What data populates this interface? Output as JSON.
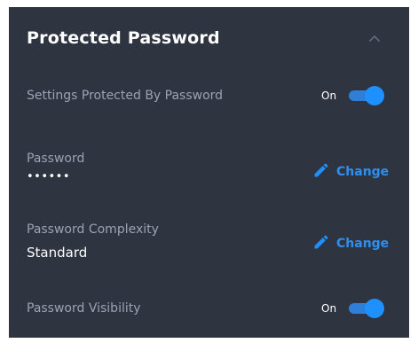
{
  "section": {
    "title": "Protected Password",
    "collapse_icon": "chevron-up-icon"
  },
  "settings": {
    "protected_by_password": {
      "label": "Settings Protected By Password",
      "state": "On"
    },
    "password": {
      "label": "Password",
      "value": "••••••",
      "action": "Change",
      "action_icon": "pencil-icon"
    },
    "complexity": {
      "label": "Password Complexity",
      "value": "Standard",
      "action": "Change",
      "action_icon": "pencil-icon"
    },
    "visibility": {
      "label": "Password Visibility",
      "state": "On"
    }
  },
  "colors": {
    "panel_bg": "#2e3440",
    "accent": "#1e90ff",
    "label": "#9aa3b2",
    "text": "#ffffff"
  }
}
